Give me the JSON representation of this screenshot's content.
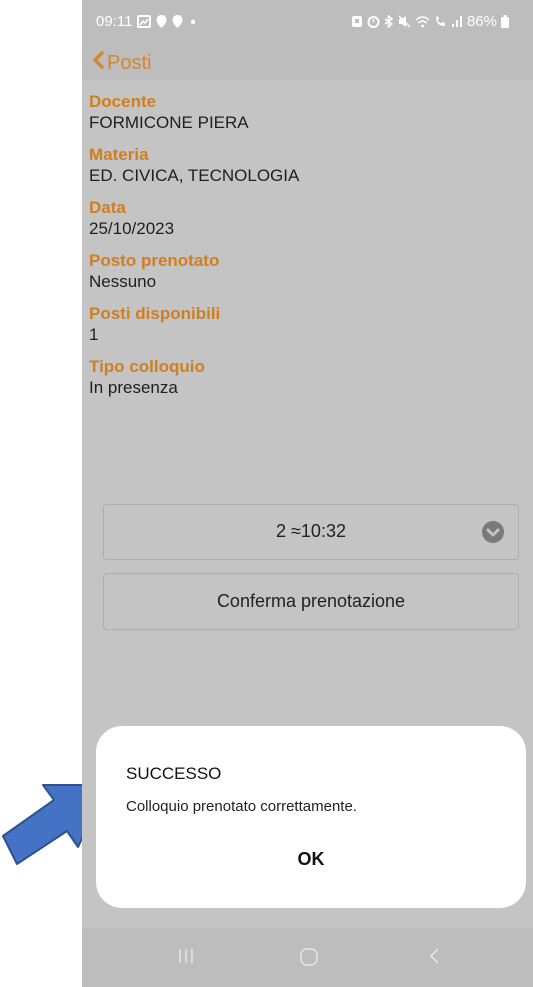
{
  "status_bar": {
    "time": "09:11",
    "battery": "86%",
    "left_icons": [
      "gallery-icon",
      "location-pin-icon",
      "location-pin-icon",
      "dot-icon"
    ],
    "right_icons": [
      "alarm-icon",
      "alarm-clock-icon",
      "bluetooth-icon",
      "mute-icon",
      "wifi-icon",
      "call-signal-icon",
      "cellular-signal-icon",
      "battery-icon"
    ]
  },
  "navbar": {
    "back_label": "Posti",
    "accent_color": "#d4862e"
  },
  "details": [
    {
      "label": "Docente",
      "value": "FORMICONE PIERA"
    },
    {
      "label": "Materia",
      "value": "ED. CIVICA, TECNOLOGIA"
    },
    {
      "label": "Data",
      "value": "25/10/2023"
    },
    {
      "label": "Posto prenotato",
      "value": "Nessuno"
    },
    {
      "label": "Posti disponibili",
      "value": "1"
    },
    {
      "label": "Tipo colloquio",
      "value": "In presenza"
    }
  ],
  "slot_select": {
    "value": "2 ≈10:32"
  },
  "confirm_button": {
    "label": "Conferma prenotazione"
  },
  "dialog": {
    "title": "SUCCESSO",
    "message": "Colloquio prenotato correttamente.",
    "ok_label": "OK"
  },
  "system_nav": {
    "icons": [
      "recent-apps-icon",
      "home-icon",
      "back-icon"
    ]
  },
  "annotation": {
    "arrow_color": "#4472c4"
  }
}
